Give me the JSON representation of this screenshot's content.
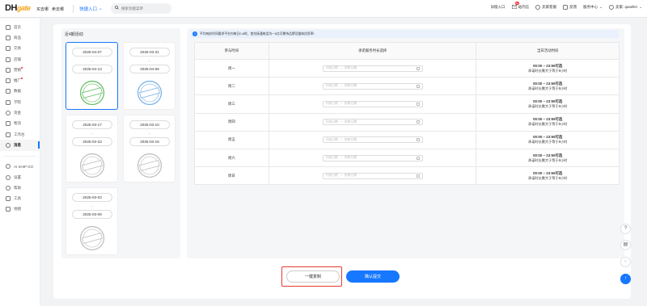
{
  "brand": {
    "logo_main": "DH",
    "logo_sub": "gate"
  },
  "top": {
    "links": [
      "买去哪",
      "卖去哪"
    ],
    "quick_entry": "快捷入口",
    "search_placeholder": "搜索功能菜单",
    "nav": [
      {
        "label": "旧版入口",
        "icon": "switch-icon"
      },
      {
        "label": "站内信",
        "icon": "mail-icon",
        "badge": "99"
      },
      {
        "label": "卖家客服",
        "icon": "chat-icon"
      },
      {
        "label": "反馈",
        "icon": "feedback-icon"
      },
      {
        "label": "服务中心",
        "icon": "chevron-down-icon"
      },
      {
        "label": "卖家: qaseller",
        "icon": "user-icon"
      }
    ]
  },
  "sidebar": {
    "items": [
      {
        "label": "首页",
        "icon": "home-icon"
      },
      {
        "label": "商品",
        "icon": "box-icon"
      },
      {
        "label": "交易",
        "icon": "trade-icon"
      },
      {
        "label": "店铺",
        "icon": "shop-icon"
      },
      {
        "label": "营销",
        "icon": "megaphone-icon",
        "dot": true
      },
      {
        "label": "推广",
        "icon": "promote-icon",
        "dot": true
      },
      {
        "label": "数据",
        "icon": "chart-icon"
      },
      {
        "label": "学院",
        "icon": "book-icon"
      },
      {
        "label": "资金",
        "icon": "money-icon"
      },
      {
        "label": "物流",
        "icon": "truck-icon"
      },
      {
        "label": "工作台",
        "icon": "desk-icon"
      },
      {
        "label": "消息",
        "icon": "message-icon",
        "active": true
      }
    ],
    "bottom_items": [
      {
        "label": "AI SHIP GO",
        "icon": "ai-icon"
      },
      {
        "label": "设置",
        "icon": "settings-icon"
      },
      {
        "label": "帮助",
        "icon": "help-icon"
      },
      {
        "label": "工具",
        "icon": "tool-icon"
      },
      {
        "label": "地图",
        "icon": "map-icon"
      }
    ]
  },
  "activities": {
    "title": "近4期活动",
    "tilde": "~",
    "cards": [
      {
        "start": "2025-04-07",
        "end": "2025-04-13",
        "stamp_color": "#6abf69",
        "selected": true
      },
      {
        "start": "2025-03-31",
        "end": "2025-04-06",
        "stamp_color": "#7fb3e6"
      },
      {
        "start": "2025-03-17",
        "end": "2025-03-23",
        "stamp_color": "#c0c0c0"
      },
      {
        "start": "2025-03-10",
        "end": "2025-03-16",
        "stamp_color": "#c0c0c0"
      },
      {
        "start": "2025-03-03",
        "end": "2025-03-09",
        "stamp_color": "#c0c0c0"
      }
    ]
  },
  "notice": {
    "text": "平均响应时间要求平台内每日0-8时，首先接通电话均一8点可期待品牌及整体优质率!"
  },
  "schedule": {
    "headers": [
      "参与时间",
      "承诺服务时长选择",
      "当日活动时间"
    ],
    "start_placeholder": "开始日期",
    "range_sep": "~",
    "end_placeholder": "结束日期",
    "rows": [
      {
        "day": "周一",
        "time": "00:00 ~ 23:59可选",
        "rule": "承诺时长需大于等于8小时"
      },
      {
        "day": "周二",
        "time": "00:00 ~ 23:59可选",
        "rule": "承诺时长需大于等于8小时"
      },
      {
        "day": "周三",
        "time": "00:00 ~ 23:59可选",
        "rule": "承诺时长需大于等于8小时"
      },
      {
        "day": "周四",
        "time": "00:00 ~ 23:59可选",
        "rule": "承诺时长需大于等于8小时"
      },
      {
        "day": "周五",
        "time": "00:00 ~ 23:59可选",
        "rule": "承诺时长需大于等于8小时"
      },
      {
        "day": "周六",
        "time": "00:00 ~ 23:59可选",
        "rule": "承诺时长需大于等于8小时"
      },
      {
        "day": "周日",
        "time": "00:00 ~ 23:59可选",
        "rule": "承诺时长需大于等于8小时"
      }
    ]
  },
  "buttons": {
    "copy": "一键复制",
    "submit": "确认提交"
  },
  "floats": {
    "help": "?",
    "doc": "▤",
    "chat": "◌",
    "top": "↑"
  },
  "colors": {
    "accent": "#1677ff",
    "highlight": "#e53935"
  }
}
